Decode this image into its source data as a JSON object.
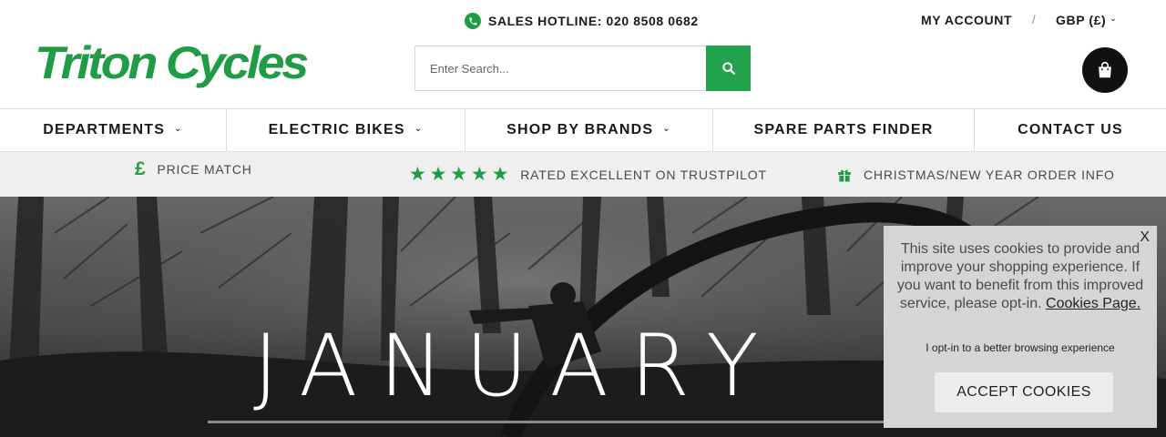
{
  "brand": {
    "name": "Triton Cycles",
    "color": "#1f9c45"
  },
  "header": {
    "hotline": "SALES HOTLINE: 020 8508 0682",
    "account": "MY ACCOUNT",
    "separator": "/",
    "currency": "GBP (£)",
    "icons": {
      "phone": "phone-icon",
      "search": "search-icon",
      "cart": "shopping-bag-icon",
      "chevron": "chevron-down-icon"
    }
  },
  "search": {
    "placeholder": "Enter Search...",
    "value": ""
  },
  "nav": {
    "items": [
      {
        "label": "DEPARTMENTS",
        "has_dropdown": true
      },
      {
        "label": "ELECTRIC BIKES",
        "has_dropdown": true
      },
      {
        "label": "SHOP BY BRANDS",
        "has_dropdown": true
      },
      {
        "label": "SPARE PARTS FINDER",
        "has_dropdown": false
      },
      {
        "label": "CONTACT US",
        "has_dropdown": false
      }
    ]
  },
  "usp": {
    "price_match": {
      "icon": "£",
      "label": "PRICE MATCH"
    },
    "trustpilot": {
      "stars": "★★★★★",
      "rating": 5,
      "label": "RATED EXCELLENT ON TRUSTPILOT"
    },
    "christmas": {
      "icon": "gift-icon",
      "label": "CHRISTMAS/NEW YEAR ORDER INFO"
    }
  },
  "hero": {
    "title": "JANUARY"
  },
  "cookie": {
    "close": "X",
    "message": "This site uses cookies to provide and improve your shopping experience. If you want to benefit from this improved service, please opt-in.",
    "link": "Cookies Page.",
    "optin": "I opt-in to a better browsing experience",
    "button": "ACCEPT COOKIES"
  }
}
